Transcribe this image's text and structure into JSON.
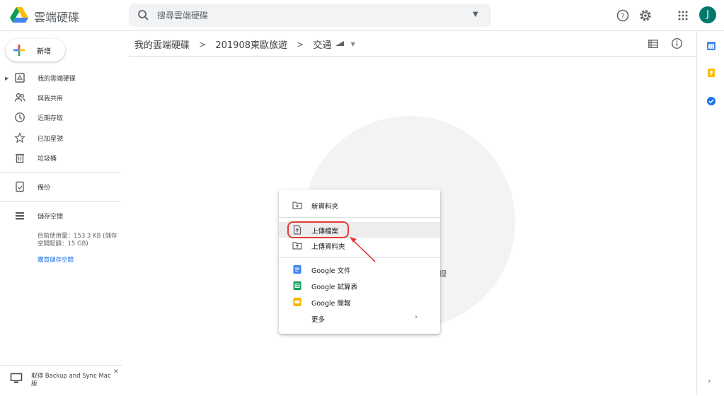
{
  "header": {
    "app_title": "雲端硬碟",
    "search": {
      "placeholder": "搜尋雲端硬碟"
    },
    "avatar_initial": "J"
  },
  "sidebar": {
    "new_button_label": "新增",
    "items": [
      {
        "label": "我的雲端硬碟",
        "icon": "my-drive-icon"
      },
      {
        "label": "與我共用",
        "icon": "shared-people-icon"
      },
      {
        "label": "近期存取",
        "icon": "clock-icon"
      },
      {
        "label": "已加星號",
        "icon": "star-icon"
      },
      {
        "label": "垃圾桶",
        "icon": "trash-icon"
      },
      {
        "label": "備份",
        "icon": "backup-icon"
      },
      {
        "label": "儲存空間",
        "icon": "storage-icon"
      }
    ],
    "storage": {
      "usage_line1": "目前使用量：153.3 KB (儲存",
      "usage_line2": "空間配額：15 GB)",
      "buy_link": "購買儲存空間"
    },
    "backup_banner": "取得 Backup and Sync Mac 版"
  },
  "breadcrumb": {
    "root": "我的雲端硬碟",
    "folder": "201908東歐旅遊",
    "current": "交通"
  },
  "content": {
    "empty_text_fragment": "理"
  },
  "context_menu": {
    "items": [
      {
        "label": "新資料夾",
        "icon": "new-folder-icon"
      },
      {
        "label": "上傳檔案",
        "icon": "file-upload-icon"
      },
      {
        "label": "上傳資料夾",
        "icon": "folder-upload-icon"
      },
      {
        "label": "Google 文件",
        "icon": "google-docs-icon"
      },
      {
        "label": "Google 試算表",
        "icon": "google-sheets-icon"
      },
      {
        "label": "Google 簡報",
        "icon": "google-slides-icon"
      },
      {
        "label": "更多",
        "icon": "more-chevron-icon"
      }
    ]
  },
  "colors": {
    "accent_blue": "#1a73e8",
    "highlight_red": "#e53935",
    "docs_blue": "#4285f4",
    "sheets_green": "#0f9d58",
    "slides_yellow": "#f4b400",
    "avatar_teal": "#00796b"
  }
}
